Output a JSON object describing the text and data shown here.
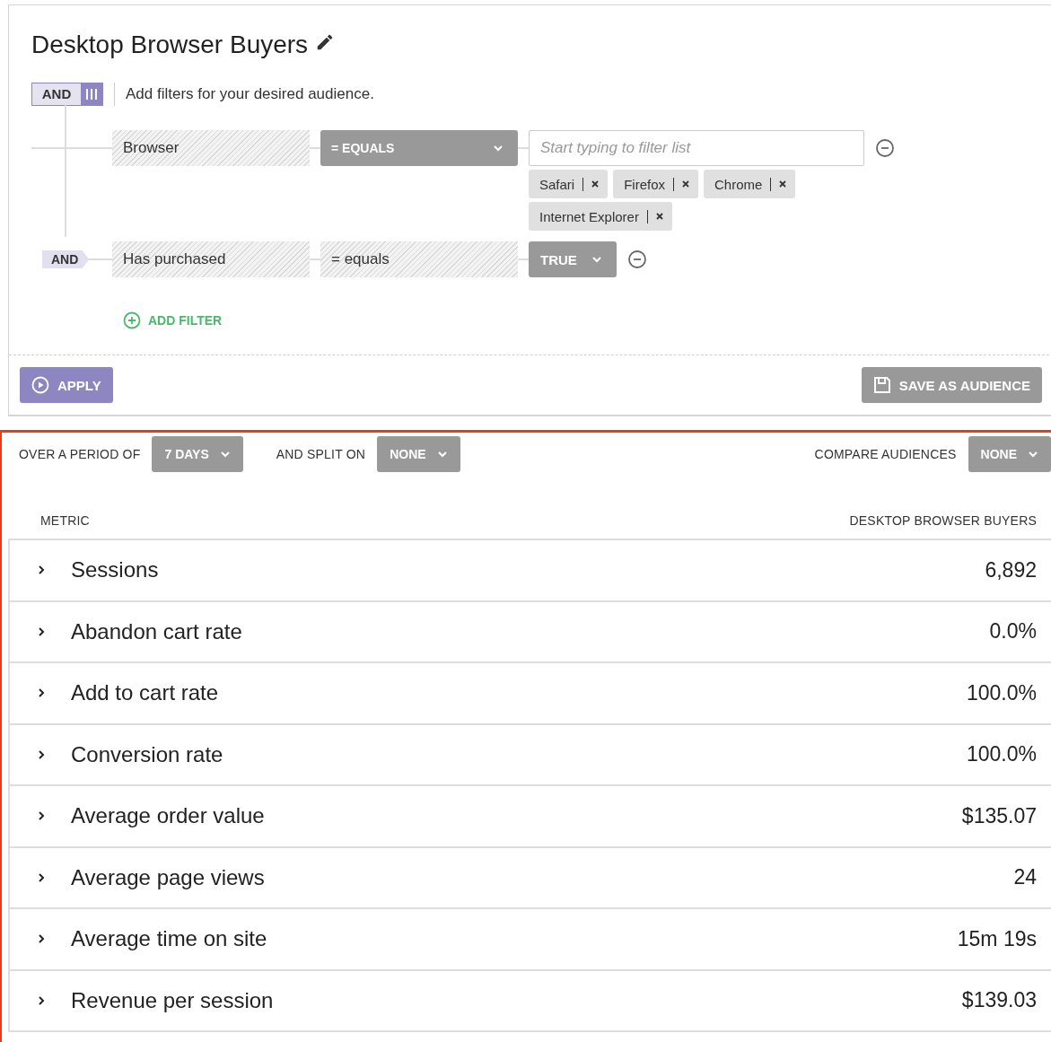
{
  "title": "Desktop Browser Buyers",
  "logic": {
    "label": "AND",
    "hint": "Add filters for your desired audience."
  },
  "filters": [
    {
      "field": "Browser",
      "operator": {
        "kind": "dropdown",
        "label": "= EQUALS"
      },
      "value": {
        "kind": "list",
        "placeholder": "Start typing to filter list",
        "tags": [
          "Safari",
          "Firefox",
          "Chrome",
          "Internet Explorer"
        ]
      }
    },
    {
      "connector": "AND",
      "field": "Has purchased",
      "operator": {
        "kind": "static",
        "label": "= equals"
      },
      "value": {
        "kind": "dropdown",
        "label": "TRUE"
      }
    }
  ],
  "add_filter": "ADD FILTER",
  "apply": "APPLY",
  "save": "SAVE AS AUDIENCE",
  "controls": [
    {
      "label": "OVER A PERIOD OF",
      "value": "7 DAYS"
    },
    {
      "label": "AND SPLIT ON",
      "value": "NONE"
    },
    {
      "label": "COMPARE AUDIENCES",
      "value": "NONE"
    }
  ],
  "table": {
    "columns": [
      "METRIC",
      "DESKTOP BROWSER BUYERS"
    ],
    "rows": [
      {
        "metric": "Sessions",
        "value": "6,892",
        "expanded": false
      },
      {
        "metric": "Abandon cart rate",
        "value": "0.0%",
        "expanded": false
      },
      {
        "metric": "Add to cart rate",
        "value": "100.0%",
        "expanded": false
      },
      {
        "metric": "Conversion rate",
        "value": "100.0%",
        "expanded": false
      },
      {
        "metric": "Average order value",
        "value": "$135.07",
        "expanded": false
      },
      {
        "metric": "Average page views",
        "value": "24",
        "expanded": false
      },
      {
        "metric": "Average time on site",
        "value": "15m 19s",
        "expanded": false
      },
      {
        "metric": "Revenue per session",
        "value": "$139.03",
        "expanded": false
      }
    ]
  }
}
